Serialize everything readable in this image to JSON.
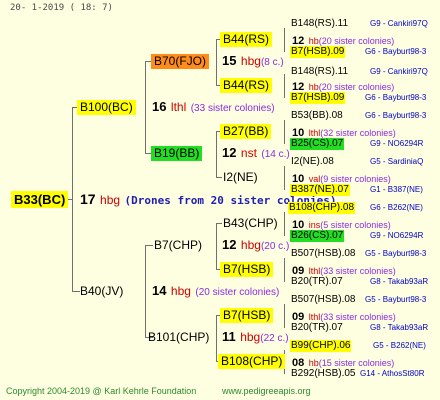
{
  "header": {
    "date": "20-  1-2019 ( 18:  7)"
  },
  "footer": {
    "copyright": "Copyright 2004-2019 @ Karl Kehrle Foundation",
    "site": "www.pedigreeapis.org"
  },
  "root": {
    "name": "B33(BC)",
    "gen": "17",
    "place": "hbg",
    "colonies": "(Drones from 20 sister colonies)"
  },
  "g1": [
    {
      "name": "B100(BC)",
      "gen": "16",
      "place": "lthl",
      "colonies": "(33 sister colonies)"
    },
    {
      "name": "B40(JV)",
      "gen": "14",
      "place": "hbg",
      "colonies": "(20 sister colonies)"
    }
  ],
  "g2": [
    {
      "name": "B70(FJO)",
      "gen": "15",
      "place": "hbg",
      "colonies": "(8 c.)"
    },
    {
      "name": "B19(BB)",
      "gen": "12",
      "place": "nst",
      "colonies": "(14 c.)"
    },
    {
      "name": "B7(CHP)",
      "gen": "12",
      "place": "hbg",
      "colonies": "(20 c.)"
    },
    {
      "name": "B101(CHP)",
      "gen": "11",
      "place": "hbg",
      "colonies": "(22 c.)"
    }
  ],
  "g3": [
    {
      "name": "B44(RS)",
      "gen": "12",
      "place": "hb",
      "colonies": "(20 sister colonies)"
    },
    {
      "name": "B44(RS)",
      "gen": "12",
      "place": "hb",
      "colonies": "(20 sister colonies)"
    },
    {
      "name": "B27(BB)",
      "gen": "10",
      "place": "lthl",
      "colonies": "(32 sister colonies)"
    },
    {
      "name": "I2(NE)",
      "gen": "10",
      "place": "val",
      "colonies": "(9 sister colonies)"
    },
    {
      "name": "B43(CHP)",
      "gen": "10",
      "place": "ins",
      "colonies": "(5 sister colonies)"
    },
    {
      "name": "B7(HSB)",
      "gen": "09",
      "place": "lthl",
      "colonies": "(33 sister colonies)"
    },
    {
      "name": "B7(HSB)",
      "gen": "09",
      "place": "lthl",
      "colonies": "(33 sister colonies)"
    },
    {
      "name": "B108(CHP)",
      "gen": "08",
      "place": "hb",
      "colonies": "(15 sister colonies)"
    }
  ],
  "g4": [
    {
      "name": "B148(RS).11",
      "extra": "G9 - Cankiri97Q"
    },
    {
      "name": "B7(HSB).09",
      "extra": "G6 - Bayburt98-3"
    },
    {
      "name": "B148(RS).11",
      "extra": "G9 - Cankiri97Q"
    },
    {
      "name": "B7(HSB).09",
      "extra": "G6 - Bayburt98-3"
    },
    {
      "name": "B53(BB).08",
      "extra": "G6 - Bayburt98-3"
    },
    {
      "name": "B25(CS).07",
      "extra": "G9 - NO6294R"
    },
    {
      "name": "I2(NE).08",
      "extra": "G5 - SardiniaQ"
    },
    {
      "name": "B387(NE).07",
      "extra": "G1 - B387(NE)"
    },
    {
      "name": "B108(CHP).08",
      "extra": "G6 - B262(NE)"
    },
    {
      "name": "B26(CS).07",
      "extra": "G9 - NO6294R"
    },
    {
      "name": "B507(HSB).08",
      "extra": "G5 - Bayburt98-3"
    },
    {
      "name": "B20(TR).07",
      "extra": "G8 - Takab93aR"
    },
    {
      "name": "B507(HSB).08",
      "extra": "G5 - Bayburt98-3"
    },
    {
      "name": "B20(TR).07",
      "extra": "G8 - Takab93aR"
    },
    {
      "name": "B99(CHP).06",
      "extra": "G5 - B262(NE)"
    },
    {
      "name": "B292(HSB).05",
      "extra": "G14 - AthosSt80R"
    }
  ]
}
